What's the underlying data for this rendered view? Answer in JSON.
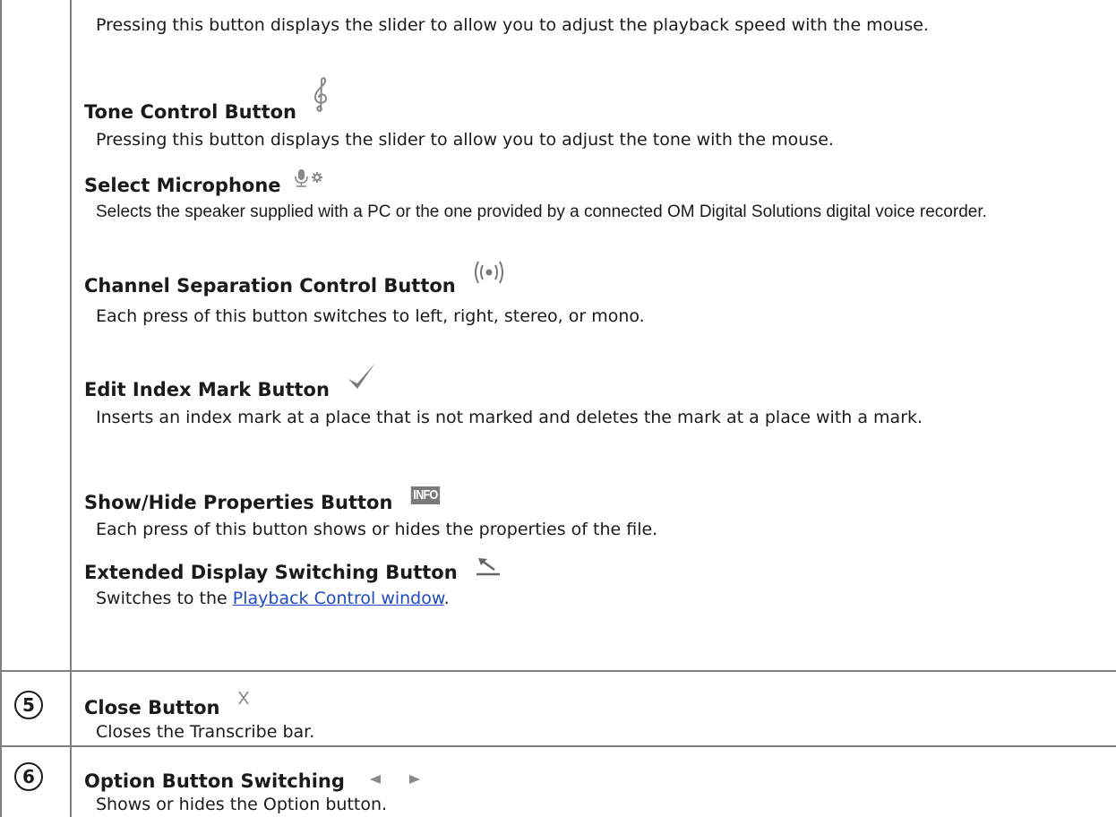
{
  "rows": {
    "speed_desc": "Pressing this button displays the slider to allow you to adjust the playback speed with the mouse.",
    "tone": {
      "title": "Tone Control Button",
      "icon": "treble-clef-icon",
      "desc": "Pressing this button displays the slider to allow you to adjust the tone with the mouse."
    },
    "mic": {
      "title": "Select Microphone",
      "icon": "microphone-settings-icon",
      "desc": "Selects the speaker supplied with a PC or the one provided by a connected OM Digital Solutions digital voice recorder."
    },
    "channel": {
      "title": "Channel Separation Control Button",
      "icon": "channel-separation-icon",
      "desc": "Each press of this button switches to left, right, stereo, or mono."
    },
    "index": {
      "title": "Edit Index Mark Button",
      "icon": "checkmark-icon",
      "desc": "Inserts an index mark at a place that is not marked and deletes the mark at a place with a mark."
    },
    "props": {
      "title": "Show/Hide Properties Button",
      "icon": "info-icon",
      "icon_text": "INFO",
      "desc": "Each press of this button shows or hides the properties of the file."
    },
    "extended": {
      "title": "Extended Display Switching Button",
      "icon": "extended-display-icon",
      "desc_prefix": "Switches to the ",
      "link": "Playback Control window",
      "desc_suffix": "."
    }
  },
  "close": {
    "num": "5",
    "title": "Close Button",
    "icon": "close-x-icon",
    "desc": "Closes the Transcribe bar."
  },
  "option": {
    "num": "6",
    "title": "Option Button Switching",
    "icons": [
      "triangle-left-icon",
      "triangle-right-icon"
    ],
    "desc": "Shows or hides the Option button."
  },
  "colors": {
    "border": "#7f7f7f",
    "link": "#1f49c5",
    "icon": "#888888"
  }
}
